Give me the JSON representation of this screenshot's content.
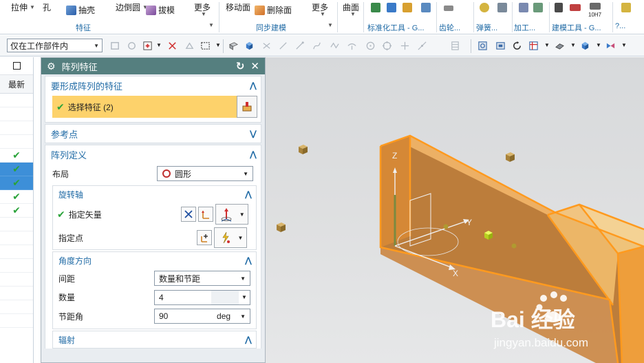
{
  "ribbon": {
    "items": [
      "拉伸",
      "孔",
      "抽壳",
      "边倒圆",
      "拔模",
      "更多",
      "移动面",
      "删除面",
      "更多",
      "曲面"
    ],
    "groups": [
      "特征",
      "同步建模",
      "标准化工具 - G...",
      "齿轮...",
      "弹簧...",
      "加工...",
      "建模工具 - G...",
      "?..."
    ],
    "mini_label": "10H7"
  },
  "toolbar": {
    "selection_filter": "仅在工作部件内"
  },
  "left_nav": {
    "column_header": "最新"
  },
  "dialog": {
    "title": "阵列特征",
    "sec_features": {
      "title": "要形成阵列的特征",
      "select_label": "选择特征 (2)"
    },
    "sec_reference": {
      "title": "参考点"
    },
    "sec_definition": {
      "title": "阵列定义",
      "layout_label": "布局",
      "layout_value": "圆形",
      "rotation_axis": {
        "title": "旋转轴",
        "vector_label": "指定矢量",
        "point_label": "指定点"
      },
      "angle_direction": {
        "title": "角度方向",
        "spacing_label": "间距",
        "spacing_value": "数量和节距",
        "count_label": "数量",
        "count_value": "4",
        "pitch_label": "节距角",
        "pitch_value": "90",
        "pitch_unit": "deg"
      },
      "radial": {
        "title": "辐射"
      }
    }
  },
  "viewport": {
    "axis_z": "Z",
    "axis_y": "Y",
    "axis_x": "X",
    "watermark_logo": "Bai 经验",
    "watermark_url": "jingyan.baidu.com"
  },
  "colors": {
    "dialog_title_bg": "#557f7f",
    "section_title": "#1f6aa5",
    "selected_row": "#3d8fd8",
    "feature_highlight": "#fdd26b",
    "solid_orange": "#f3a23c"
  }
}
